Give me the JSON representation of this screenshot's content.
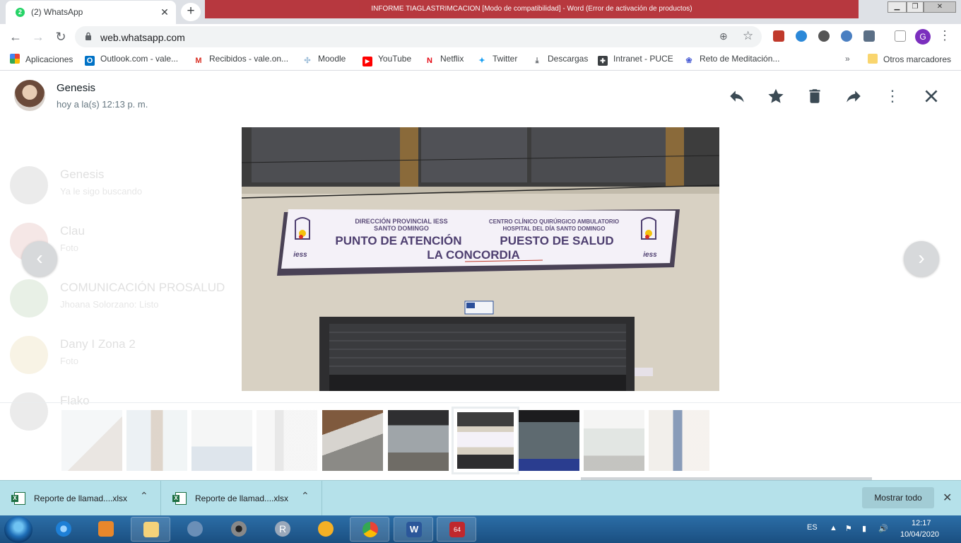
{
  "browser": {
    "tab_title": "(2) WhatsApp",
    "tab_badge": "2",
    "url": "web.whatsapp.com",
    "profile_initial": "G",
    "background_banner": "INFORME TIAGLASTRIMCACION  [Modo de compatibilidad] - Word (Error de activación de productos)"
  },
  "bookmarks": [
    {
      "label": "Aplicaciones",
      "icon": "apps-grid-icon",
      "color": "#ea4335"
    },
    {
      "label": "Outlook.com - vale...",
      "icon": "outlook-icon",
      "color": "#0072c6"
    },
    {
      "label": "Recibidos - vale.on...",
      "icon": "gmail-icon",
      "color": "#d93025"
    },
    {
      "label": "Moodle",
      "icon": "moodle-icon",
      "color": "#9bbcd8"
    },
    {
      "label": "YouTube",
      "icon": "youtube-icon",
      "color": "#ff0000"
    },
    {
      "label": "Netflix",
      "icon": "netflix-icon",
      "color": "#e50914"
    },
    {
      "label": "Twitter",
      "icon": "twitter-icon",
      "color": "#1da1f2"
    },
    {
      "label": "Descargas",
      "icon": "download-icon",
      "color": "#5f6368"
    },
    {
      "label": "Intranet - PUCE",
      "icon": "intranet-icon",
      "color": "#3c4043"
    },
    {
      "label": "Reto de Meditación...",
      "icon": "meditation-icon",
      "color": "#4c5fd5"
    },
    {
      "label": "Otros marcadores",
      "icon": "folder-icon",
      "color": "#f9d56e"
    }
  ],
  "viewer": {
    "sender_name": "Genesis",
    "sender_time": "hoy a la(s) 12:13 p. m.",
    "sign": {
      "org_left_line1": "DIRECCIÓN PROVINCIAL IESS",
      "org_left_line2": "SANTO DOMINGO",
      "org_right_line1": "CENTRO CLÍNICO QUIRÚRGICO AMBULATORIO",
      "org_right_line2": "HOSPITAL DEL DÍA SANTO DOMINGO",
      "title_left": "PUNTO DE ATENCIÓN",
      "title_right": "PUESTO DE SALUD",
      "location": "LA CONCORDIA",
      "logo_text": "iess"
    },
    "thumbnail_count": 10,
    "selected_thumbnail": 6
  },
  "background_chats": [
    {
      "name": "Genesis",
      "preview": "Ya le sigo buscando"
    },
    {
      "name": "Clau",
      "preview": "Foto"
    },
    {
      "name": "COMUNICACIÓN PROSALUD",
      "preview": "Jhoana Solorzano: Listo"
    },
    {
      "name": "Dany I Zona 2",
      "preview": "Foto"
    },
    {
      "name": "Flako",
      "preview": ""
    }
  ],
  "downloads": {
    "items": [
      {
        "name": "Reporte de llamad....xlsx"
      },
      {
        "name": "Reporte de llamad....xlsx"
      }
    ],
    "show_all_label": "Mostrar todo"
  },
  "taskbar": {
    "language": "ES",
    "time": "12:17",
    "date": "10/04/2020",
    "notification_badge": "64"
  }
}
